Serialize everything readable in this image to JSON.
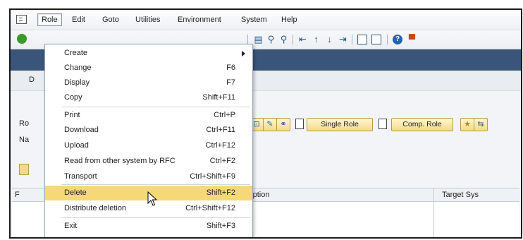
{
  "menubar": {
    "items": [
      {
        "label": "Role"
      },
      {
        "label": "Edit"
      },
      {
        "label": "Goto"
      },
      {
        "label": "Utilities"
      },
      {
        "label": "Environment"
      },
      {
        "label": "System"
      },
      {
        "label": "Help"
      }
    ]
  },
  "dropdown": {
    "items": [
      {
        "label": "Create",
        "shortcut": ""
      },
      {
        "label": "Change",
        "shortcut": "F6"
      },
      {
        "label": "Display",
        "shortcut": "F7"
      },
      {
        "label": "Copy",
        "shortcut": "Shift+F11"
      },
      {
        "label": "Print",
        "shortcut": "Ctrl+P"
      },
      {
        "label": "Download",
        "shortcut": "Ctrl+F11"
      },
      {
        "label": "Upload",
        "shortcut": "Ctrl+F12"
      },
      {
        "label": "Read from other system by RFC",
        "shortcut": "Ctrl+F2"
      },
      {
        "label": "Transport",
        "shortcut": "Ctrl+Shift+F9"
      },
      {
        "label": "Delete",
        "shortcut": "Shift+F2"
      },
      {
        "label": "Distribute deletion",
        "shortcut": "Ctrl+Shift+F12"
      },
      {
        "label": "Exit",
        "shortcut": "Shift+F3"
      }
    ]
  },
  "role_area": {
    "label_role_stub": "Ro",
    "label_name_stub": "Na",
    "single_role_button": "Single Role",
    "composite_role_button": "Comp. Role"
  },
  "table": {
    "col_stub": "F",
    "description_header": "cription",
    "target_sys_header": "Target Sys"
  },
  "misc": {
    "subbar_stub": "D"
  }
}
